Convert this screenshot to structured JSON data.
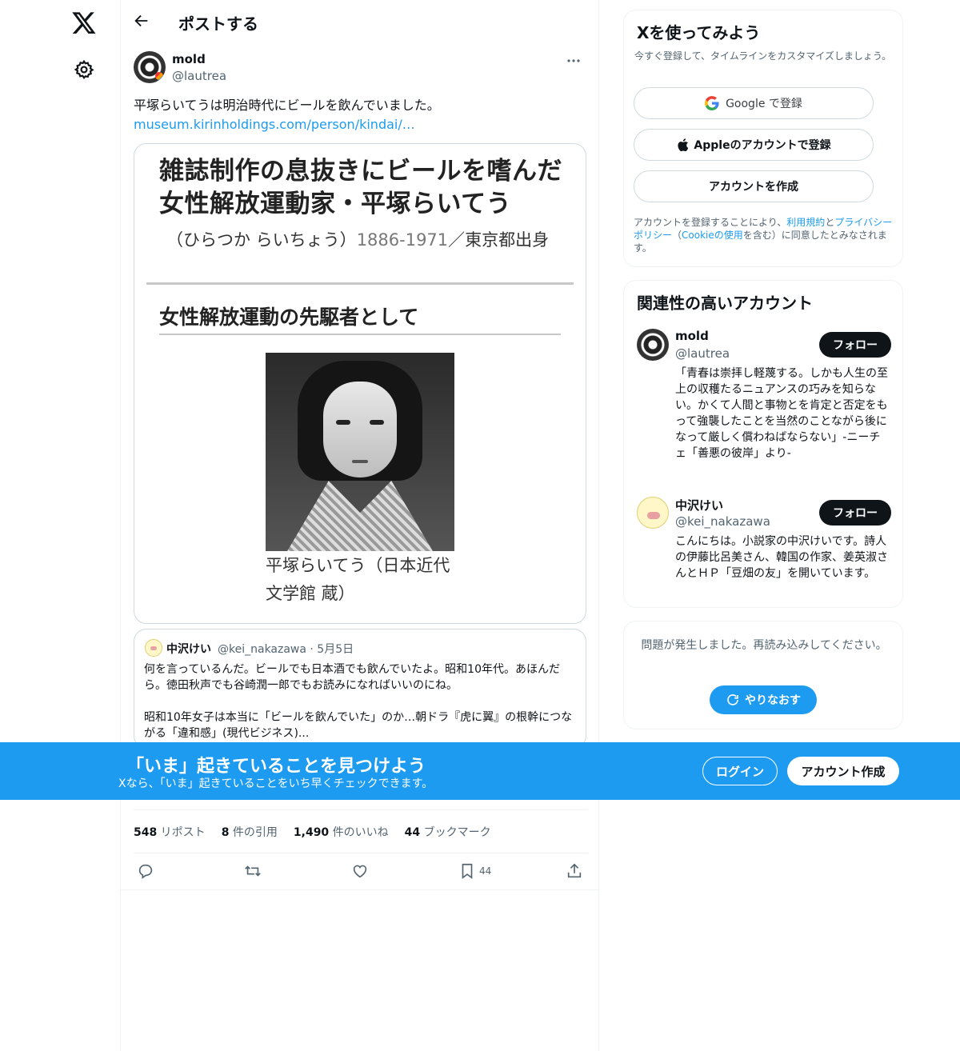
{
  "header": {
    "title": "ポストする"
  },
  "post": {
    "author_name": "mold",
    "author_handle": "@lautrea",
    "text": "平塚らいてうは明治時代にビールを飲んでいました。",
    "link": "museum.kirinholdings.com/person/kindai/…",
    "media": {
      "heading_line1": "雑誌制作の息抜きにビールを嗜んだ",
      "heading_line2": "女性解放運動家・平塚らいてう",
      "reading": "（ひらつか らいちょう）",
      "years": "1886-1971",
      "origin": "／東京都出身",
      "section": "女性解放運動の先駆者として",
      "caption_line1": "平塚らいてう（日本近代",
      "caption_line2": "文学館 蔵）"
    },
    "quote": {
      "name": "中沢けい",
      "meta": "@kei_nakazawa · 5月5日",
      "text": "何を言っているんだ。ビールでも日本酒でも飲んでいたよ。昭和10年代。あほんだら。徳田秋声でも谷崎潤一郎でもお読みになればいいのにね。\n\n昭和10年女子は本当に「ビールを飲んでいた」のか…朝ドラ『虎に翼』の根幹につながる「違和感」(現代ビジネス)..."
    },
    "stats": {
      "reposts_count": "548",
      "reposts_label": " リポスト",
      "quotes_count": "8",
      "quotes_label": " 件の引用",
      "likes_count": "1,490",
      "likes_label": " 件のいいね",
      "bookmarks_count": "44",
      "bookmarks_label": " ブックマーク"
    },
    "bookmark_action_count": "44"
  },
  "signup": {
    "title": "Xを使ってみよう",
    "subtitle": "今すぐ登録して、タイムラインをカスタマイズしましょう。",
    "google_button": "Google で登録",
    "apple_button": "Appleのアカウントで登録",
    "create_button": "アカウントを作成",
    "terms_pre": "アカウントを登録することにより、",
    "terms_link1": "利用規約",
    "terms_mid1": "と",
    "terms_link2": "プライバシーポリシー",
    "terms_mid2": "（",
    "terms_link3": "Cookieの使用",
    "terms_post": "を含む）に同意したとみなされます。"
  },
  "related": {
    "title": "関連性の高いアカウント",
    "follow_label": "フォロー",
    "users": [
      {
        "name": "mold",
        "handle": "@lautrea",
        "bio": "「青春は崇拝し軽蔑する。しかも人生の至上の収穫たるニュアンスの巧みを知らない。かくて人間と事物とを肯定と否定をもって強襲したことを当然のことながら後になって厳しく償わねばならない」-ニーチェ「善悪の彼岸」より-"
      },
      {
        "name": "中沢けい",
        "handle": "@kei_nakazawa",
        "bio": "こんにちは。小説家の中沢けいです。詩人の伊藤比呂美さん、韓国の作家、姜英淑さんとＨＰ「豆畑の友」を開いています。"
      }
    ]
  },
  "error": {
    "message": "問題が発生しました。再読み込みしてください。",
    "retry_label": "やりなおす"
  },
  "banner": {
    "title": "「いま」起きていることを見つけよう",
    "subtitle": "Xなら、「いま」起きていることをいち早くチェックできます。",
    "login_label": "ログイン",
    "signup_label": "アカウント作成"
  },
  "colors": {
    "accent": "#1d9bf0",
    "text": "#0f1419",
    "muted": "#536471",
    "border": "#cfd9de"
  }
}
